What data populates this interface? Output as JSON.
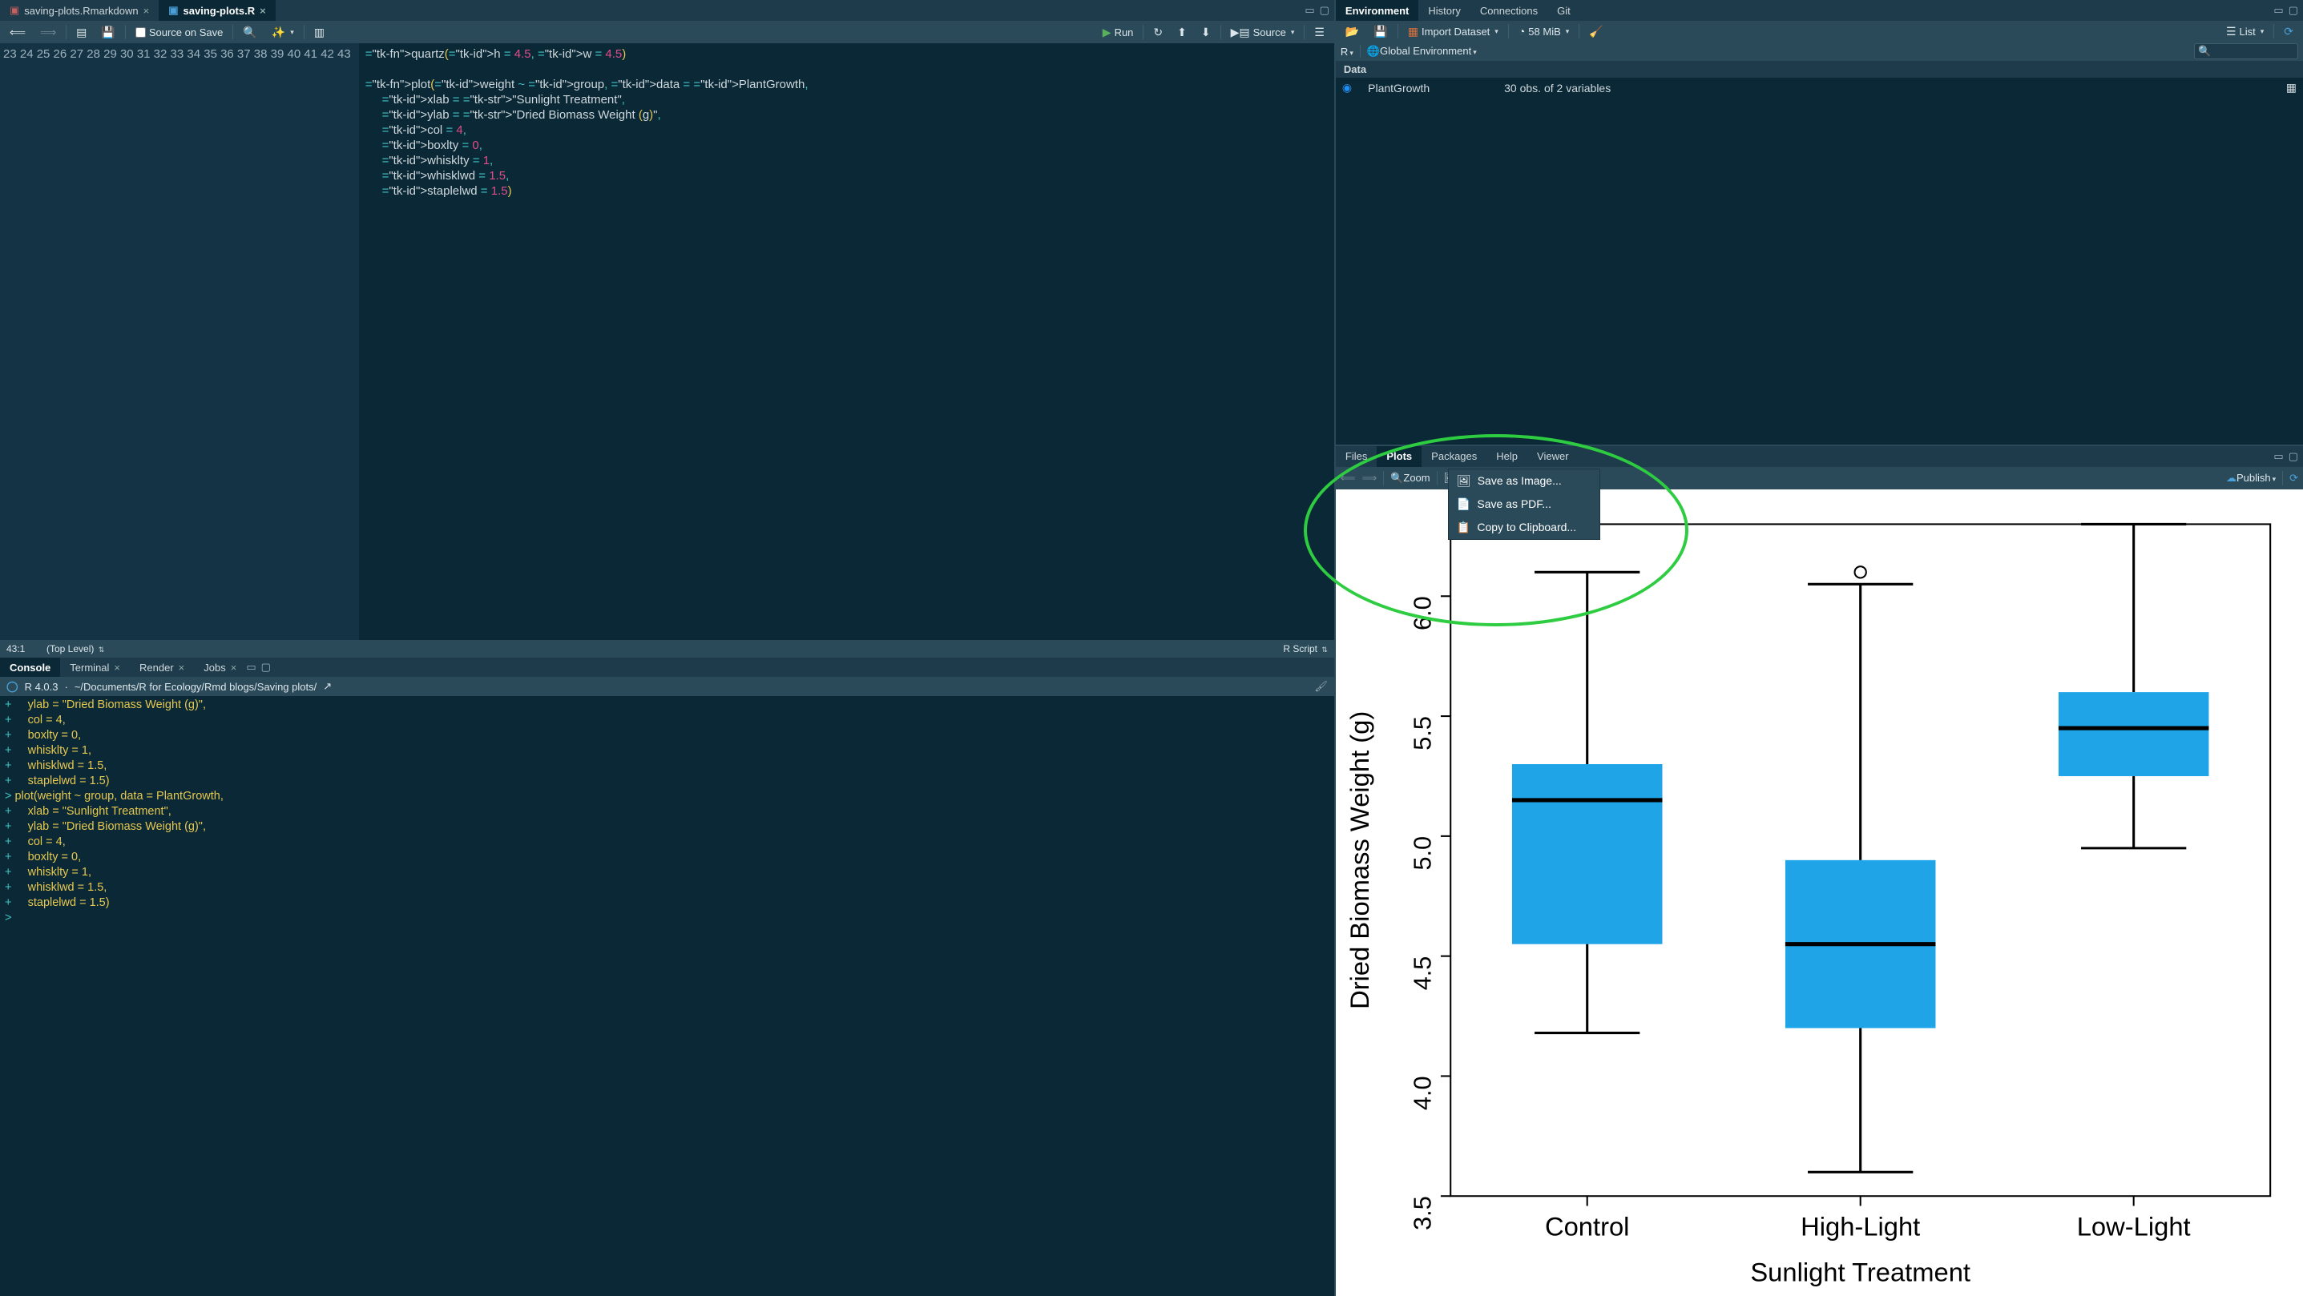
{
  "source_pane": {
    "tabs": [
      {
        "label": "saving-plots.Rmarkdown",
        "active": false
      },
      {
        "label": "saving-plots.R",
        "active": true
      }
    ],
    "toolbar": {
      "source_on_save": "Source on Save",
      "run": "Run",
      "source": "Source"
    },
    "first_line_no": 23,
    "last_line_no": 43,
    "code_lines": [
      {
        "raw": "quartz(h = 4.5, w = 4.5)"
      },
      {
        "raw": ""
      },
      {
        "raw": "plot(weight ~ group, data = PlantGrowth,"
      },
      {
        "raw": "     xlab = \"Sunlight Treatment\","
      },
      {
        "raw": "     ylab = \"Dried Biomass Weight (g)\","
      },
      {
        "raw": "     col = 4,"
      },
      {
        "raw": "     boxlty = 0,"
      },
      {
        "raw": "     whisklty = 1,"
      },
      {
        "raw": "     whisklwd = 1.5,"
      },
      {
        "raw": "     staplelwd = 1.5)"
      },
      {
        "raw": ""
      },
      {
        "raw": ""
      },
      {
        "raw": ""
      },
      {
        "raw": ""
      },
      {
        "raw": ""
      },
      {
        "raw": ""
      },
      {
        "raw": ""
      },
      {
        "raw": ""
      },
      {
        "raw": ""
      },
      {
        "raw": ""
      },
      {
        "raw": ""
      }
    ],
    "status": {
      "pos": "43:1",
      "scope": "(Top Level)",
      "lang": "R Script"
    }
  },
  "console_pane": {
    "tabs": [
      "Console",
      "Terminal",
      "Render",
      "Jobs"
    ],
    "active_tab": 0,
    "header": {
      "r_version": "R 4.0.3",
      "wd": "~/Documents/R for Ecology/Rmd blogs/Saving plots/"
    },
    "lines": [
      {
        "p": "+",
        "t": "     ylab = \"Dried Biomass Weight (g)\","
      },
      {
        "p": "+",
        "t": "     col = 4,"
      },
      {
        "p": "+",
        "t": "     boxlty = 0,"
      },
      {
        "p": "+",
        "t": "     whisklty = 1,"
      },
      {
        "p": "+",
        "t": "     whisklwd = 1.5,"
      },
      {
        "p": "+",
        "t": "     staplelwd = 1.5)"
      },
      {
        "p": ">",
        "t": " plot(weight ~ group, data = PlantGrowth,"
      },
      {
        "p": "+",
        "t": "     xlab = \"Sunlight Treatment\","
      },
      {
        "p": "+",
        "t": "     ylab = \"Dried Biomass Weight (g)\","
      },
      {
        "p": "+",
        "t": "     col = 4,"
      },
      {
        "p": "+",
        "t": "     boxlty = 0,"
      },
      {
        "p": "+",
        "t": "     whisklty = 1,"
      },
      {
        "p": "+",
        "t": "     whisklwd = 1.5,"
      },
      {
        "p": "+",
        "t": "     staplelwd = 1.5)"
      },
      {
        "p": ">",
        "t": " "
      }
    ]
  },
  "env_pane": {
    "tabs": [
      "Environment",
      "History",
      "Connections",
      "Git"
    ],
    "active_tab": 0,
    "toolbar": {
      "import": "Import Dataset",
      "mem": "58 MiB",
      "view": "List"
    },
    "scope_toolbar": {
      "lang": "R",
      "scope": "Global Environment"
    },
    "section": "Data",
    "rows": [
      {
        "name": "PlantGrowth",
        "desc": "30 obs. of 2 variables"
      }
    ],
    "search_placeholder": ""
  },
  "plots_pane": {
    "tabs": [
      "Files",
      "Plots",
      "Packages",
      "Help",
      "Viewer"
    ],
    "active_tab": 1,
    "toolbar": {
      "zoom": "Zoom",
      "export": "Export",
      "publish": "Publish"
    },
    "export_menu": [
      "Save as Image...",
      "Save as PDF...",
      "Copy to Clipboard..."
    ]
  },
  "chart_data": {
    "type": "boxplot",
    "title": "",
    "xlabel": "Sunlight Treatment",
    "ylabel": "Dried Biomass Weight (g)",
    "ylim": [
      3.5,
      6.3
    ],
    "yticks": [
      3.5,
      4.0,
      4.5,
      5.0,
      5.5,
      6.0
    ],
    "categories": [
      "Control",
      "High-Light",
      "Low-Light"
    ],
    "series": [
      {
        "name": "Control",
        "min": 4.18,
        "q1": 4.55,
        "median": 5.15,
        "q3": 5.3,
        "max": 6.1,
        "outliers": []
      },
      {
        "name": "High-Light",
        "min": 3.6,
        "q1": 4.2,
        "median": 4.55,
        "q3": 4.9,
        "max": 6.05,
        "outliers": [
          6.1
        ]
      },
      {
        "name": "Low-Light",
        "min": 4.95,
        "q1": 5.25,
        "median": 5.45,
        "q3": 5.6,
        "max": 6.3,
        "outliers": []
      }
    ],
    "box_fill": "#1fa4e8",
    "stroke": "#000"
  }
}
